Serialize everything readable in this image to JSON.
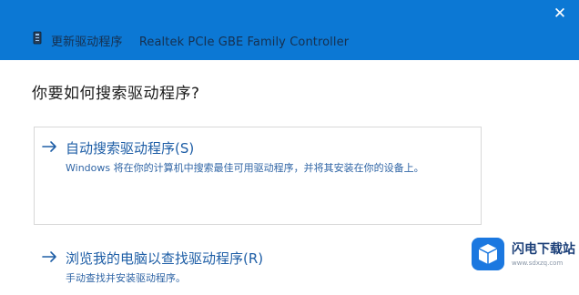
{
  "window": {
    "close_glyph": "✕",
    "device_icon": "device-manager-icon",
    "page_name": "更新驱动程序",
    "device_name": "Realtek PCIe GBE Family Controller"
  },
  "question": "你要如何搜索驱动程序?",
  "options": [
    {
      "icon": "arrow-right-icon",
      "title": "自动搜索驱动程序(S)",
      "description": "Windows 将在你的计算机中搜索最佳可用驱动程序，并将其安装在你的设备上。"
    },
    {
      "icon": "arrow-right-icon",
      "title": "浏览我的电脑以查找驱动程序(R)",
      "description": "手动查找并安装驱动程序。"
    }
  ],
  "watermark": {
    "name": "闪电下载站",
    "url": "www.sdxzq.com"
  },
  "colors": {
    "titlebar": "#0c78d4",
    "link": "#1e5ea6",
    "text": "#1b1b1b"
  }
}
